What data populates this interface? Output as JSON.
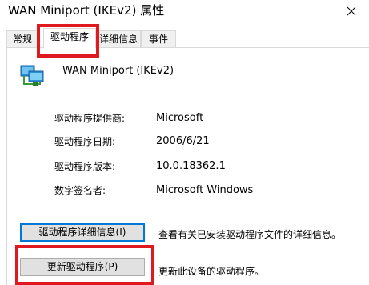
{
  "window": {
    "title": "WAN Miniport (IKEv2) 属性"
  },
  "tabs": [
    {
      "label": "常规"
    },
    {
      "label": "驱动程序"
    },
    {
      "label": "详细信息"
    },
    {
      "label": "事件"
    }
  ],
  "device": {
    "name": "WAN Miniport (IKEv2)",
    "icon": "network-adapter-icon"
  },
  "properties": [
    {
      "label": "驱动程序提供商:",
      "value": "Microsoft"
    },
    {
      "label": "驱动程序日期:",
      "value": "2006/6/21"
    },
    {
      "label": "驱动程序版本:",
      "value": "10.0.18362.1"
    },
    {
      "label": "数字签名者:",
      "value": "Microsoft Windows"
    }
  ],
  "buttons": [
    {
      "label": "驱动程序详细信息(I)",
      "description": "查看有关已安装驱动程序文件的详细信息。"
    },
    {
      "label": "更新驱动程序(P)",
      "description": "更新此设备的驱动程序。"
    }
  ],
  "colors": {
    "highlight": "#e0191f",
    "focus": "#0078d7"
  }
}
